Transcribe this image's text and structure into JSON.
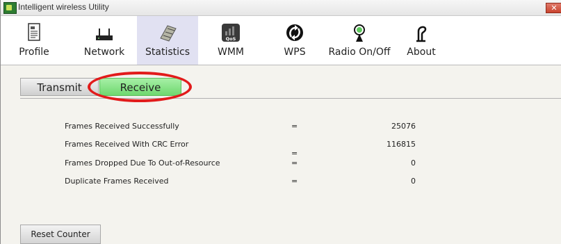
{
  "window": {
    "title": "Intelligent wireless Utility",
    "close_glyph": "✕"
  },
  "toolbar": {
    "items": [
      {
        "label": "Profile",
        "icon": "profile-icon"
      },
      {
        "label": "Network",
        "icon": "router-icon"
      },
      {
        "label": "Statistics",
        "icon": "statistics-icon"
      },
      {
        "label": "WMM",
        "icon": "qos-icon"
      },
      {
        "label": "WPS",
        "icon": "wps-icon"
      },
      {
        "label": "Radio On/Off",
        "icon": "radio-icon"
      },
      {
        "label": "About",
        "icon": "about-icon"
      }
    ],
    "active": "Statistics"
  },
  "tabs": {
    "transmit": "Transmit",
    "receive": "Receive",
    "active": "Receive"
  },
  "stats": {
    "rows": [
      {
        "label": "Frames Received Successfully",
        "eq": "=",
        "value": "25076"
      },
      {
        "label": "Frames Received With CRC Error",
        "eq": "",
        "value": "116815"
      },
      {
        "label": "Frames Dropped Due To Out-of-Resource",
        "eq": "=",
        "value": "0"
      },
      {
        "label": "Duplicate Frames Received",
        "eq": "=",
        "value": "0"
      }
    ],
    "stray_eq": "="
  },
  "buttons": {
    "reset_counter": "Reset Counter"
  },
  "colors": {
    "receive_tab": "#7fe07f",
    "active_toolbar_bg": "#e1e1f2",
    "highlight_ring": "#e21b1b"
  },
  "wmm_icon_text": "QoS"
}
